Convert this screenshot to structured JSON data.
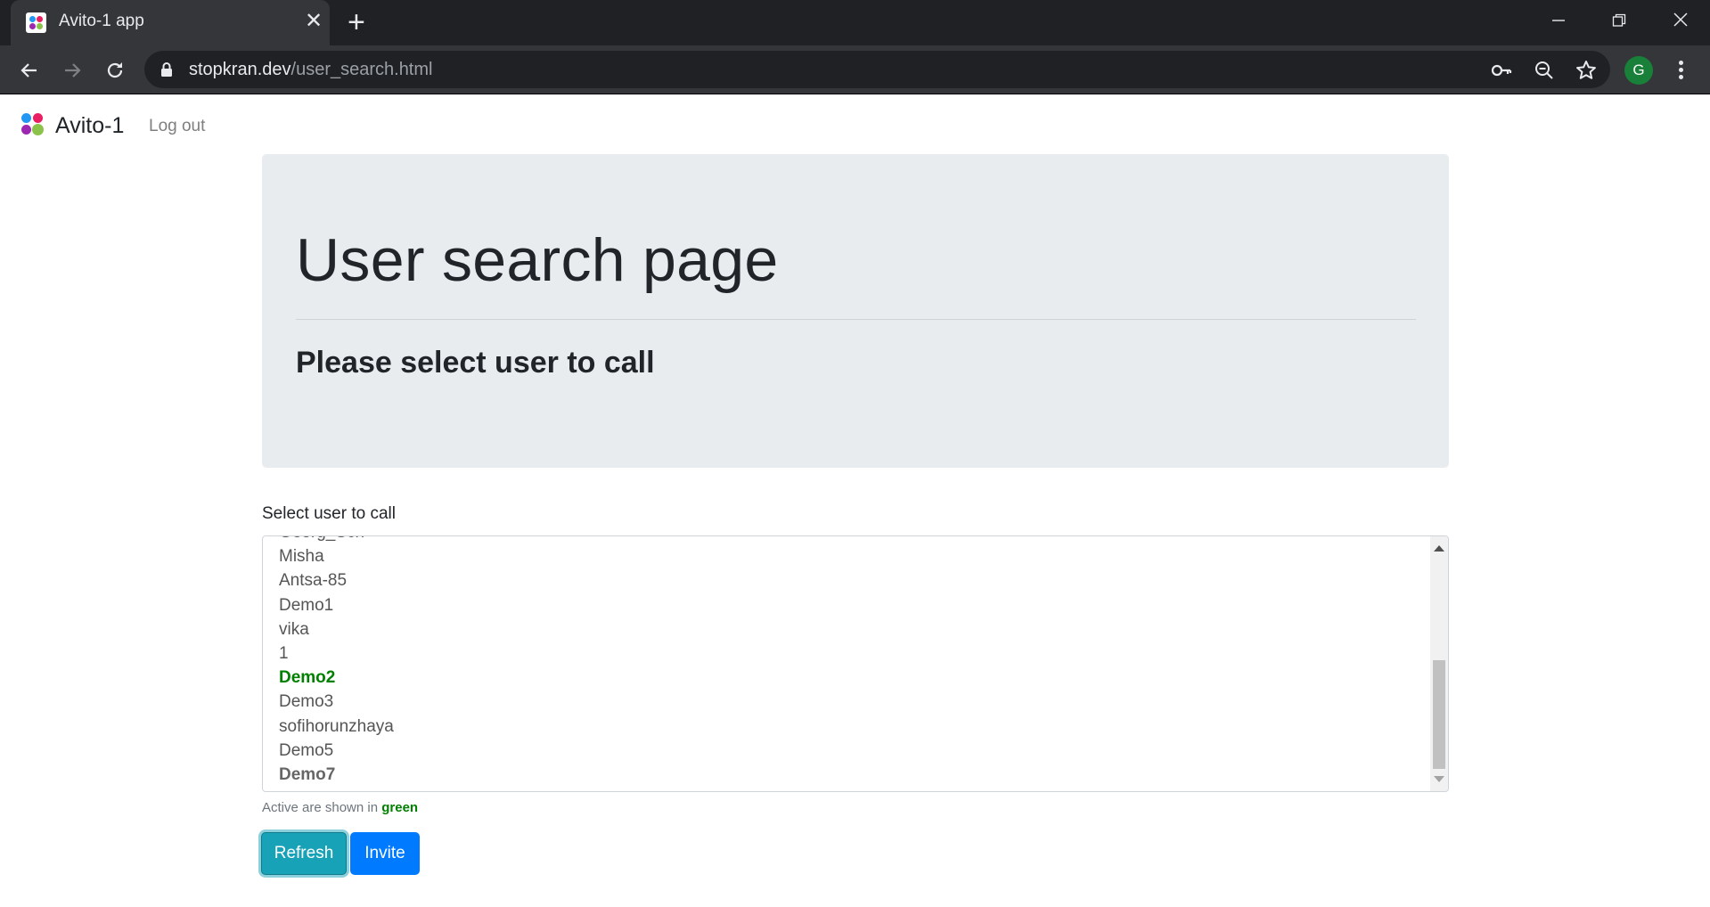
{
  "browser": {
    "tab_title": "Avito-1 app",
    "url_host": "stopkran.dev",
    "url_path": "/user_search.html",
    "profile_initial": "G"
  },
  "navbar": {
    "brand": "Avito-1",
    "logout": "Log out"
  },
  "jumbotron": {
    "title": "User search page",
    "subtitle": "Please select user to call"
  },
  "user_select": {
    "label": "Select user to call",
    "options": [
      {
        "name": "Georg_Sch",
        "state": "normal"
      },
      {
        "name": "Misha",
        "state": "normal"
      },
      {
        "name": "Antsa-85",
        "state": "normal"
      },
      {
        "name": "Demo1",
        "state": "normal"
      },
      {
        "name": "vika",
        "state": "normal"
      },
      {
        "name": "1",
        "state": "normal"
      },
      {
        "name": "Demo2",
        "state": "active"
      },
      {
        "name": "Demo3",
        "state": "normal"
      },
      {
        "name": "sofihorunzhaya",
        "state": "normal"
      },
      {
        "name": "Demo5",
        "state": "normal"
      },
      {
        "name": "Demo7",
        "state": "bold"
      }
    ],
    "hint_prefix": "Active are shown in ",
    "hint_color_word": "green"
  },
  "buttons": {
    "refresh": "Refresh",
    "invite": "Invite"
  },
  "colors": {
    "active_user": "#008000",
    "refresh_button": "#17a2b8",
    "invite_button": "#007bff",
    "jumbotron_bg": "#e9ecef"
  }
}
